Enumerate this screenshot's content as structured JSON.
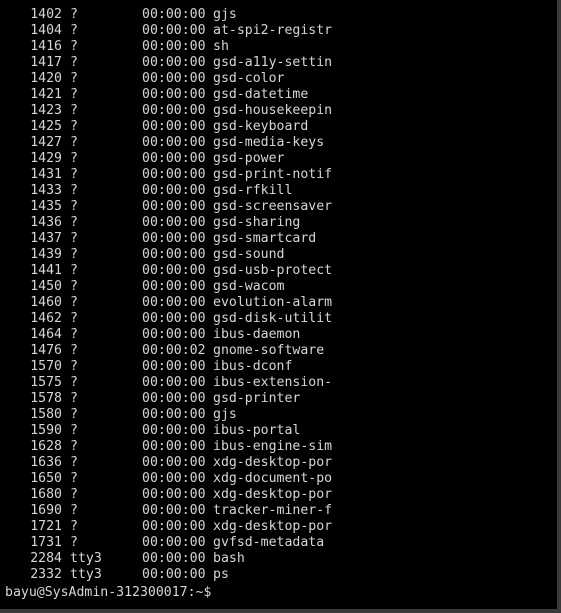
{
  "processes": [
    {
      "pid": "1402",
      "tty": "?",
      "time": "00:00:00",
      "cmd": "gjs"
    },
    {
      "pid": "1404",
      "tty": "?",
      "time": "00:00:00",
      "cmd": "at-spi2-registr"
    },
    {
      "pid": "1416",
      "tty": "?",
      "time": "00:00:00",
      "cmd": "sh"
    },
    {
      "pid": "1417",
      "tty": "?",
      "time": "00:00:00",
      "cmd": "gsd-a11y-settin"
    },
    {
      "pid": "1420",
      "tty": "?",
      "time": "00:00:00",
      "cmd": "gsd-color"
    },
    {
      "pid": "1421",
      "tty": "?",
      "time": "00:00:00",
      "cmd": "gsd-datetime"
    },
    {
      "pid": "1423",
      "tty": "?",
      "time": "00:00:00",
      "cmd": "gsd-housekeepin"
    },
    {
      "pid": "1425",
      "tty": "?",
      "time": "00:00:00",
      "cmd": "gsd-keyboard"
    },
    {
      "pid": "1427",
      "tty": "?",
      "time": "00:00:00",
      "cmd": "gsd-media-keys"
    },
    {
      "pid": "1429",
      "tty": "?",
      "time": "00:00:00",
      "cmd": "gsd-power"
    },
    {
      "pid": "1431",
      "tty": "?",
      "time": "00:00:00",
      "cmd": "gsd-print-notif"
    },
    {
      "pid": "1433",
      "tty": "?",
      "time": "00:00:00",
      "cmd": "gsd-rfkill"
    },
    {
      "pid": "1435",
      "tty": "?",
      "time": "00:00:00",
      "cmd": "gsd-screensaver"
    },
    {
      "pid": "1436",
      "tty": "?",
      "time": "00:00:00",
      "cmd": "gsd-sharing"
    },
    {
      "pid": "1437",
      "tty": "?",
      "time": "00:00:00",
      "cmd": "gsd-smartcard"
    },
    {
      "pid": "1439",
      "tty": "?",
      "time": "00:00:00",
      "cmd": "gsd-sound"
    },
    {
      "pid": "1441",
      "tty": "?",
      "time": "00:00:00",
      "cmd": "gsd-usb-protect"
    },
    {
      "pid": "1450",
      "tty": "?",
      "time": "00:00:00",
      "cmd": "gsd-wacom"
    },
    {
      "pid": "1460",
      "tty": "?",
      "time": "00:00:00",
      "cmd": "evolution-alarm"
    },
    {
      "pid": "1462",
      "tty": "?",
      "time": "00:00:00",
      "cmd": "gsd-disk-utilit"
    },
    {
      "pid": "1464",
      "tty": "?",
      "time": "00:00:00",
      "cmd": "ibus-daemon"
    },
    {
      "pid": "1476",
      "tty": "?",
      "time": "00:00:02",
      "cmd": "gnome-software"
    },
    {
      "pid": "1570",
      "tty": "?",
      "time": "00:00:00",
      "cmd": "ibus-dconf"
    },
    {
      "pid": "1575",
      "tty": "?",
      "time": "00:00:00",
      "cmd": "ibus-extension-"
    },
    {
      "pid": "1578",
      "tty": "?",
      "time": "00:00:00",
      "cmd": "gsd-printer"
    },
    {
      "pid": "1580",
      "tty": "?",
      "time": "00:00:00",
      "cmd": "gjs"
    },
    {
      "pid": "1590",
      "tty": "?",
      "time": "00:00:00",
      "cmd": "ibus-portal"
    },
    {
      "pid": "1628",
      "tty": "?",
      "time": "00:00:00",
      "cmd": "ibus-engine-sim"
    },
    {
      "pid": "1636",
      "tty": "?",
      "time": "00:00:00",
      "cmd": "xdg-desktop-por"
    },
    {
      "pid": "1650",
      "tty": "?",
      "time": "00:00:00",
      "cmd": "xdg-document-po"
    },
    {
      "pid": "1680",
      "tty": "?",
      "time": "00:00:00",
      "cmd": "xdg-desktop-por"
    },
    {
      "pid": "1690",
      "tty": "?",
      "time": "00:00:00",
      "cmd": "tracker-miner-f"
    },
    {
      "pid": "1721",
      "tty": "?",
      "time": "00:00:00",
      "cmd": "xdg-desktop-por"
    },
    {
      "pid": "1731",
      "tty": "?",
      "time": "00:00:00",
      "cmd": "gvfsd-metadata"
    },
    {
      "pid": "2284",
      "tty": "tty3",
      "time": "00:00:00",
      "cmd": "bash"
    },
    {
      "pid": "2332",
      "tty": "tty3",
      "time": "00:00:00",
      "cmd": "ps"
    }
  ],
  "prompt": {
    "text": "bayu@SysAdmin-312300017:~$"
  },
  "colors": {
    "background": "#000000",
    "foreground": "#d6d6d6",
    "frame": "#3a3a3a"
  }
}
